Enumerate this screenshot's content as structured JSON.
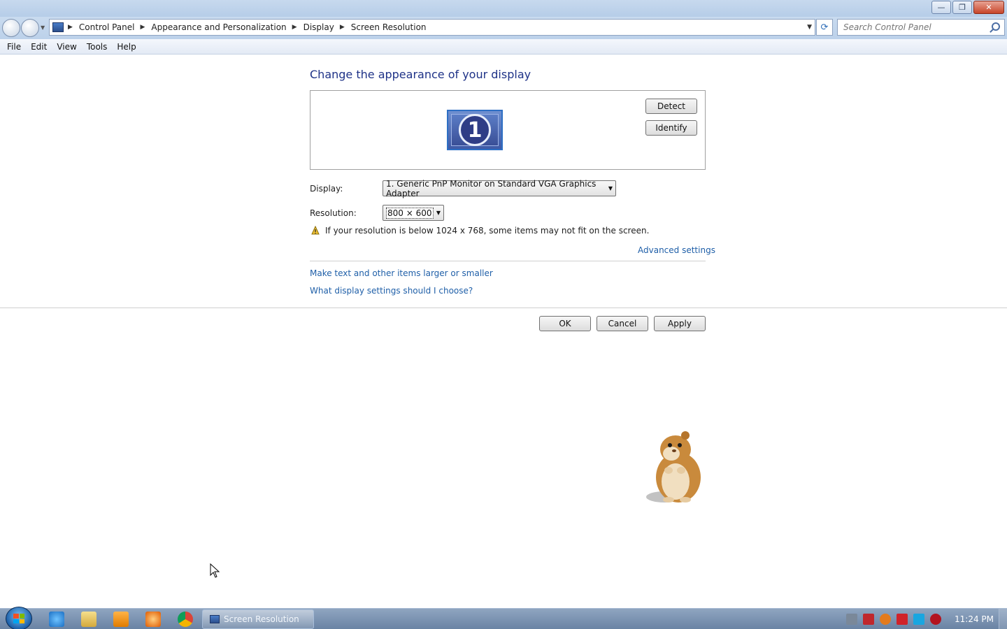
{
  "window": {
    "minimize_glyph": "—",
    "restore_glyph": "❐",
    "close_glyph": "✕"
  },
  "address_bar": {
    "breadcrumbs": [
      "Control Panel",
      "Appearance and Personalization",
      "Display",
      "Screen Resolution"
    ],
    "search_placeholder": "Search Control Panel"
  },
  "menu": [
    "File",
    "Edit",
    "View",
    "Tools",
    "Help"
  ],
  "main": {
    "heading": "Change the appearance of your display",
    "monitor_number": "1",
    "detect_label": "Detect",
    "identify_label": "Identify",
    "display_label": "Display:",
    "display_value": "1. Generic PnP Monitor on Standard VGA Graphics Adapter",
    "resolution_label": "Resolution:",
    "resolution_value": "800 × 600",
    "warning": "If your resolution is below 1024 x 768, some items may not fit on the screen.",
    "advanced_settings": "Advanced settings",
    "link_text_size": "Make text and other items larger or smaller",
    "link_which_settings": "What display settings should I choose?",
    "ok_label": "OK",
    "cancel_label": "Cancel",
    "apply_label": "Apply"
  },
  "taskbar": {
    "active_task": "Screen Resolution",
    "clock": "11:24 PM",
    "pinned_icons": [
      "internet-explorer-icon",
      "windows-explorer-icon",
      "media-player-icon",
      "paint-icon",
      "chrome-icon"
    ],
    "tray_icons": [
      "network-icon",
      "antivirus-icon",
      "search-tool-icon",
      "flag-icon",
      "display-icon",
      "volume-icon"
    ]
  },
  "colors": {
    "heading": "#1e3287",
    "link": "#1f5fa8",
    "taskbar": "#6a83a4"
  }
}
